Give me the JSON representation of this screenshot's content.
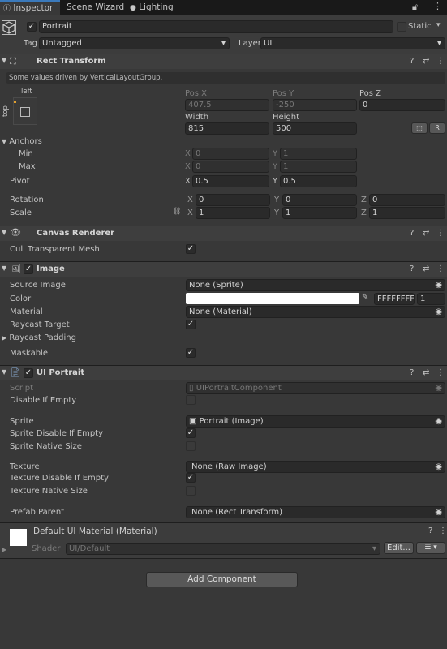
{
  "tabs": [
    {
      "label": "Inspector",
      "icon": "info-icon"
    },
    {
      "label": "Scene Wizard"
    },
    {
      "label": "Lighting",
      "icon": "bulb-icon"
    }
  ],
  "object": {
    "name": "Portrait",
    "static_label": "Static",
    "tag_label": "Tag",
    "tag_value": "Untagged",
    "layer_label": "Layer",
    "layer_value": "UI"
  },
  "rect_transform": {
    "title": "Rect Transform",
    "info": "Some values driven by VerticalLayoutGroup.",
    "anchor_h": "left",
    "anchor_v": "top",
    "pos_x_label": "Pos X",
    "pos_x": "407.5",
    "pos_y_label": "Pos Y",
    "pos_y": "-250",
    "pos_z_label": "Pos Z",
    "pos_z": "0",
    "width_label": "Width",
    "width": "815",
    "height_label": "Height",
    "height": "500",
    "r_label": "R",
    "anchors_label": "Anchors",
    "min_label": "Min",
    "min_x": "0",
    "min_y": "1",
    "max_label": "Max",
    "max_x": "0",
    "max_y": "1",
    "pivot_label": "Pivot",
    "pivot_x": "0.5",
    "pivot_y": "0.5",
    "rotation_label": "Rotation",
    "rot_x": "0",
    "rot_y": "0",
    "rot_z": "0",
    "scale_label": "Scale",
    "scale_x": "1",
    "scale_y": "1",
    "scale_z": "1",
    "x": "X",
    "y": "Y",
    "z": "Z"
  },
  "canvas_renderer": {
    "title": "Canvas Renderer",
    "cull_label": "Cull Transparent Mesh"
  },
  "image": {
    "title": "Image",
    "source_image_label": "Source Image",
    "source_image": "None (Sprite)",
    "color_label": "Color",
    "color_hex": "FFFFFFFF",
    "color_alpha": "1",
    "color_value": "#ffffff",
    "material_label": "Material",
    "material": "None (Material)",
    "raycast_target_label": "Raycast Target",
    "raycast_padding_label": "Raycast Padding",
    "maskable_label": "Maskable"
  },
  "ui_portrait": {
    "title": "UI Portrait",
    "script_label": "Script",
    "script": "UIPortraitComponent",
    "disable_if_empty_label": "Disable If Empty",
    "sprite_label": "Sprite",
    "sprite": "Portrait (Image)",
    "sprite_disable_label": "Sprite Disable If Empty",
    "sprite_native_label": "Sprite Native Size",
    "texture_label": "Texture",
    "texture": "None (Raw Image)",
    "texture_disable_label": "Texture Disable If Empty",
    "texture_native_label": "Texture Native Size",
    "prefab_parent_label": "Prefab Parent",
    "prefab_parent": "None (Rect Transform)"
  },
  "material": {
    "title": "Default UI Material (Material)",
    "shader_label": "Shader",
    "shader": "UI/Default",
    "edit_label": "Edit..."
  },
  "add_component_label": "Add Component"
}
